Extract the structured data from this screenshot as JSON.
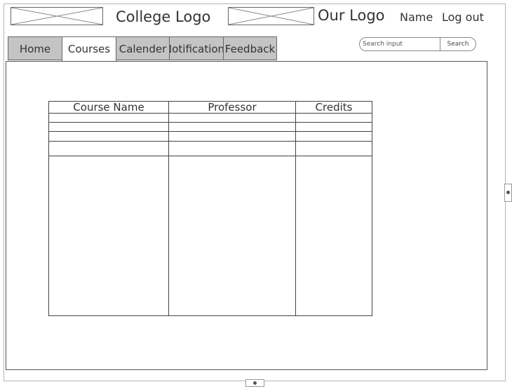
{
  "header": {
    "college_logo_text": "College Logo",
    "our_logo_text": "Our Logo",
    "user_name": "Name",
    "logout_label": "Log out"
  },
  "tabs": [
    {
      "label": "Home",
      "active": false
    },
    {
      "label": "Courses",
      "active": true
    },
    {
      "label": "Calender",
      "active": false
    },
    {
      "label": "Notifications",
      "active": false
    },
    {
      "label": "Feedback",
      "active": false
    }
  ],
  "search": {
    "placeholder": "Search input",
    "button_label": "Search"
  },
  "course_table": {
    "columns": [
      "Course Name",
      "Professor",
      "Credits"
    ],
    "rows": [
      [
        "",
        "",
        ""
      ],
      [
        "",
        "",
        ""
      ],
      [
        "",
        "",
        ""
      ],
      [
        "",
        "",
        ""
      ],
      [
        "",
        "",
        ""
      ]
    ]
  }
}
